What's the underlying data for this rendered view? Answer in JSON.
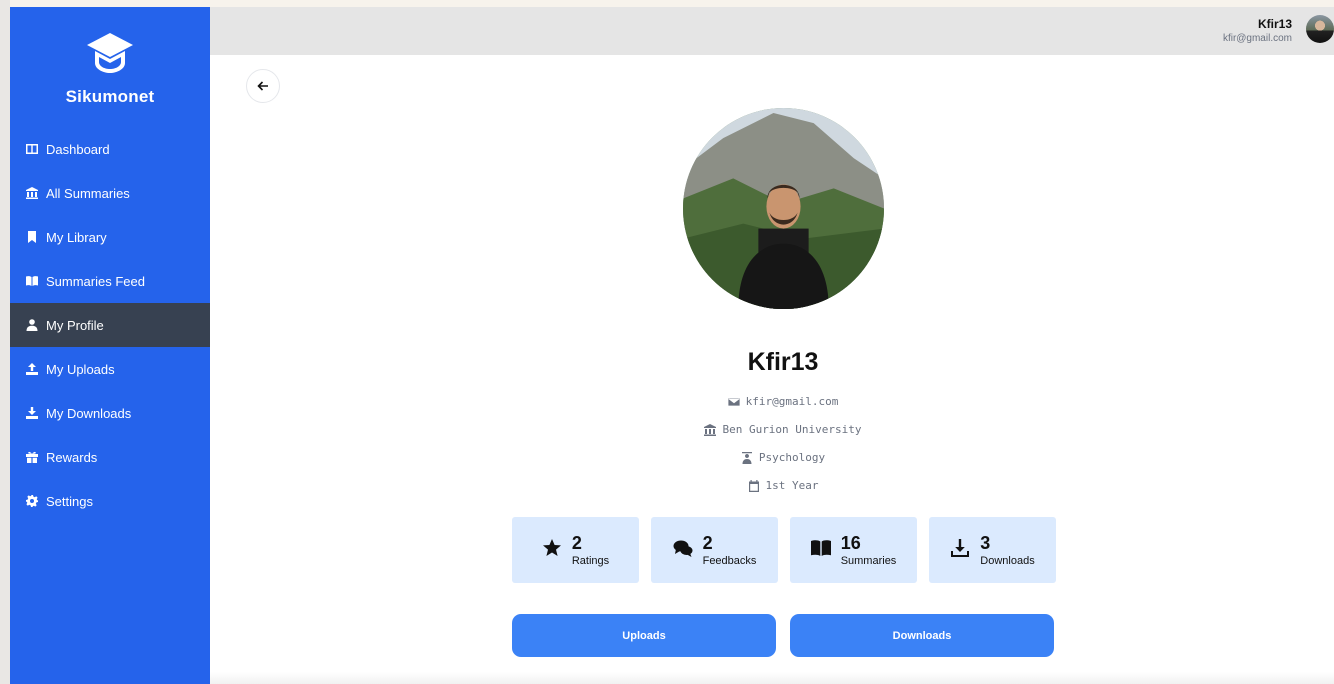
{
  "app": {
    "name": "Sikumonet"
  },
  "sidebar": {
    "items": [
      {
        "label": "Dashboard",
        "icon": "columns-icon",
        "active": false
      },
      {
        "label": "All Summaries",
        "icon": "university-icon",
        "active": false
      },
      {
        "label": "My Library",
        "icon": "bookmark-icon",
        "active": false
      },
      {
        "label": "Summaries Feed",
        "icon": "book-open-icon",
        "active": false
      },
      {
        "label": "My Profile",
        "icon": "user-icon",
        "active": true
      },
      {
        "label": "My Uploads",
        "icon": "upload-icon",
        "active": false
      },
      {
        "label": "My Downloads",
        "icon": "download-icon",
        "active": false
      },
      {
        "label": "Rewards",
        "icon": "gift-icon",
        "active": false
      },
      {
        "label": "Settings",
        "icon": "gear-icon",
        "active": false
      }
    ]
  },
  "header": {
    "user_name": "Kfir13",
    "user_email": "kfir@gmail.com"
  },
  "profile": {
    "name": "Kfir13",
    "email": "kfir@gmail.com",
    "university": "Ben Gurion University",
    "department": "Psychology",
    "year": "1st Year"
  },
  "stats": [
    {
      "value": "2",
      "label": "Ratings",
      "icon": "star-icon"
    },
    {
      "value": "2",
      "label": "Feedbacks",
      "icon": "comments-icon"
    },
    {
      "value": "16",
      "label": "Summaries",
      "icon": "book-open-icon"
    },
    {
      "value": "3",
      "label": "Downloads",
      "icon": "download-icon"
    }
  ],
  "actions": {
    "uploads_label": "Uploads",
    "downloads_label": "Downloads"
  },
  "colors": {
    "sidebar": "#2563eb",
    "active_item": "#374151",
    "stat_card": "#dbeafe",
    "button": "#3b82f6",
    "topbar": "#e5e5e5"
  }
}
